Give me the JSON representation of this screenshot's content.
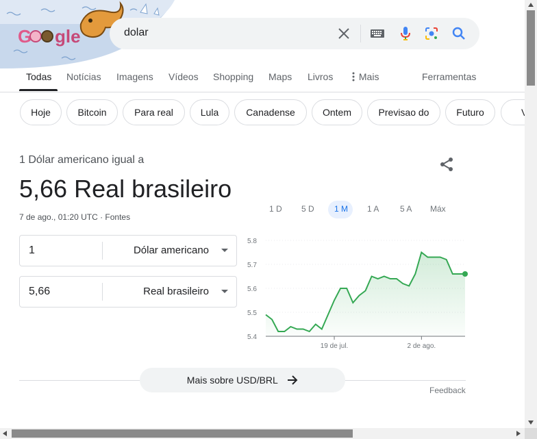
{
  "search": {
    "query": "dolar"
  },
  "tabs": [
    {
      "label": "Todas",
      "active": true
    },
    {
      "label": "Notícias"
    },
    {
      "label": "Imagens"
    },
    {
      "label": "Vídeos"
    },
    {
      "label": "Shopping"
    },
    {
      "label": "Maps"
    },
    {
      "label": "Livros"
    },
    {
      "label": "Mais"
    },
    {
      "label": "Ferramentas"
    }
  ],
  "chips": [
    "Hoje",
    "Bitcoin",
    "Para real",
    "Lula",
    "Canadense",
    "Ontem",
    "Previsao do",
    "Futuro",
    "Vai"
  ],
  "converter": {
    "label": "1 Dólar americano igual a",
    "result": "5,66 Real brasileiro",
    "date": "7 de ago., 01:20 UTC · Fontes",
    "from_value": "1",
    "from_currency": "Dólar americano",
    "to_value": "5,66",
    "to_currency": "Real brasileiro"
  },
  "ranges": [
    "1 D",
    "5 D",
    "1 M",
    "1 A",
    "5 A",
    "Máx"
  ],
  "active_range": "1 M",
  "chart_data": {
    "type": "area",
    "y_ticks": [
      "5.8",
      "5.7",
      "5.6",
      "5.5",
      "5.4"
    ],
    "x_ticks": [
      "19 de jul.",
      "2 de ago."
    ],
    "ylim": [
      5.4,
      5.8
    ],
    "values": [
      5.49,
      5.47,
      5.42,
      5.42,
      5.44,
      5.43,
      5.43,
      5.42,
      5.45,
      5.43,
      5.49,
      5.55,
      5.6,
      5.6,
      5.54,
      5.57,
      5.59,
      5.65,
      5.64,
      5.65,
      5.64,
      5.64,
      5.62,
      5.61,
      5.66,
      5.75,
      5.73,
      5.73,
      5.73,
      5.72,
      5.66,
      5.66,
      5.66
    ],
    "line_color": "#34a853"
  },
  "footer": {
    "more_label": "Mais sobre USD/BRL",
    "feedback": "Feedback"
  }
}
